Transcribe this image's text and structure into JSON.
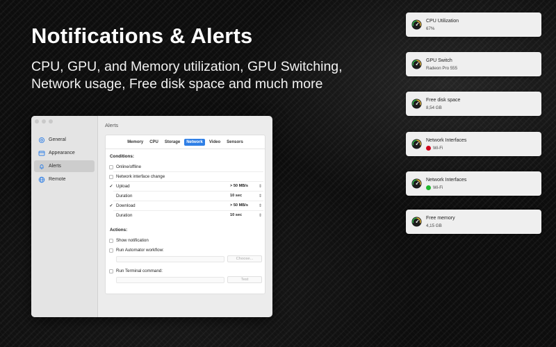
{
  "hero": {
    "title": "Notifications & Alerts",
    "subtitle_line1": "CPU, GPU, and Memory utilization, GPU Switching,",
    "subtitle_line2": "Network usage, Free disk space and much more"
  },
  "window": {
    "title": "Alerts",
    "sidebar": {
      "items": [
        {
          "label": "General",
          "icon": "gear-icon"
        },
        {
          "label": "Appearance",
          "icon": "window-icon"
        },
        {
          "label": "Alerts",
          "icon": "bell-icon",
          "active": true
        },
        {
          "label": "Remote",
          "icon": "globe-icon"
        }
      ]
    },
    "tabs": [
      {
        "label": "Memory"
      },
      {
        "label": "CPU"
      },
      {
        "label": "Storage"
      },
      {
        "label": "Network",
        "active": true
      },
      {
        "label": "Video"
      },
      {
        "label": "Sensors"
      }
    ],
    "conditions_label": "Conditions:",
    "conditions": {
      "online_offline": {
        "label": "Online/offline",
        "checked": false
      },
      "interface_change": {
        "label": "Network interface change",
        "checked": false
      },
      "upload": {
        "label": "Upload",
        "checked": true,
        "check_glyph": "✓",
        "value": "> 50 MB/s"
      },
      "upload_duration": {
        "label": "Duration",
        "value": "10 sec"
      },
      "download": {
        "label": "Download",
        "checked": true,
        "check_glyph": "✓",
        "value": "> 50 MB/s"
      },
      "download_duration": {
        "label": "Duration",
        "value": "10 sec"
      }
    },
    "actions_label": "Actions:",
    "actions": {
      "show_notification": {
        "label": "Show notification",
        "checked": false
      },
      "run_automator": {
        "label": "Run Automator workflow:",
        "checked": false,
        "button": "Choose..."
      },
      "run_terminal": {
        "label": "Run Terminal command:",
        "checked": false,
        "button": "Test"
      }
    },
    "chevron_glyph": "⌃⌄"
  },
  "notifications": [
    {
      "title": "CPU Utilization",
      "subtitle": "67%"
    },
    {
      "title": "GPU Switch",
      "subtitle": "Radeon Pro 555"
    },
    {
      "title": "Free disk space",
      "subtitle": "8,54 GB"
    },
    {
      "title": "Network Interfaces",
      "subtitle": "Wi-Fi",
      "status_color": "#d0021b"
    },
    {
      "title": "Network Interfaces",
      "subtitle": "Wi-Fi",
      "status_color": "#1fb82e"
    },
    {
      "title": "Free memory",
      "subtitle": "4,15 GB"
    }
  ],
  "colors": {
    "accent": "#2f7fe6",
    "status_down": "#d0021b",
    "status_up": "#1fb82e"
  }
}
